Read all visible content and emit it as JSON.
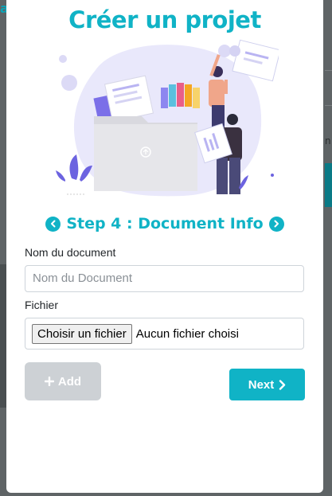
{
  "modal": {
    "title": "Créer un projet",
    "step_text": "Step 4 : Document Info",
    "fields": {
      "doc_name_label": "Nom du document",
      "doc_name_placeholder": "Nom du Document",
      "file_label": "Fichier",
      "file_button": "Choisir un fichier",
      "file_status": "Aucun fichier choisi"
    },
    "buttons": {
      "add": "Add",
      "next": "Next"
    }
  },
  "colors": {
    "accent": "#10b3c6",
    "disabled": "#cdd1d5"
  },
  "icons": {
    "prev": "chevron-left-circle-icon",
    "next_step": "chevron-right-circle-icon",
    "add": "plus-icon",
    "next": "chevron-right-icon"
  }
}
